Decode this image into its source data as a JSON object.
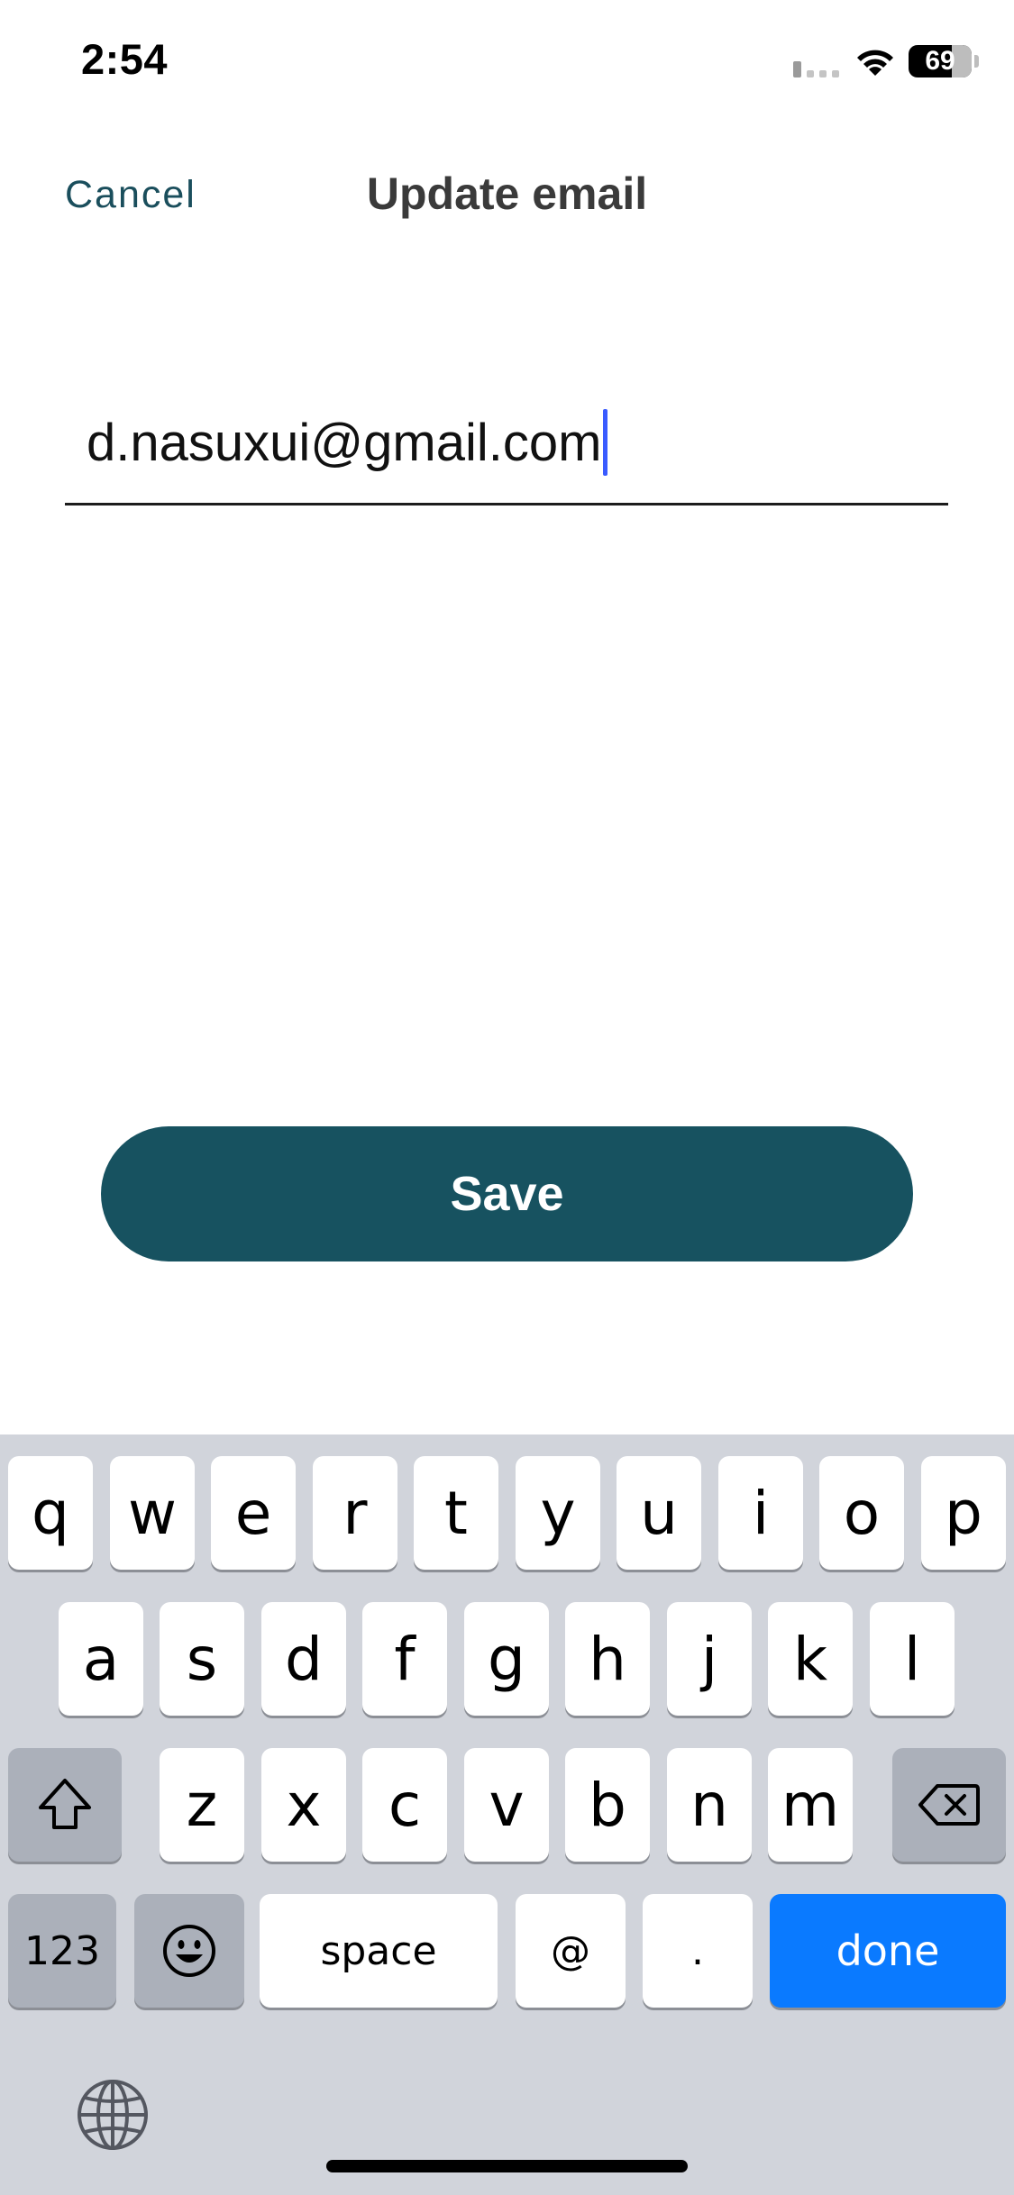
{
  "status_bar": {
    "time": "2:54",
    "battery_percent": "69",
    "battery_level": 0.69
  },
  "nav": {
    "cancel_label": "Cancel",
    "title": "Update email"
  },
  "email_field": {
    "value": "d.nasuxui@gmail.com"
  },
  "save_button": {
    "label": "Save"
  },
  "keyboard": {
    "row1": [
      "q",
      "w",
      "e",
      "r",
      "t",
      "y",
      "u",
      "i",
      "o",
      "p"
    ],
    "row2": [
      "a",
      "s",
      "d",
      "f",
      "g",
      "h",
      "j",
      "k",
      "l"
    ],
    "row3": [
      "z",
      "x",
      "c",
      "v",
      "b",
      "n",
      "m"
    ],
    "numbers_label": "123",
    "space_label": "space",
    "at_label": "@",
    "dot_label": ".",
    "done_label": "done"
  },
  "colors": {
    "accent": "#175260",
    "done_blue": "#0a7aff",
    "caret": "#3a5bff"
  }
}
